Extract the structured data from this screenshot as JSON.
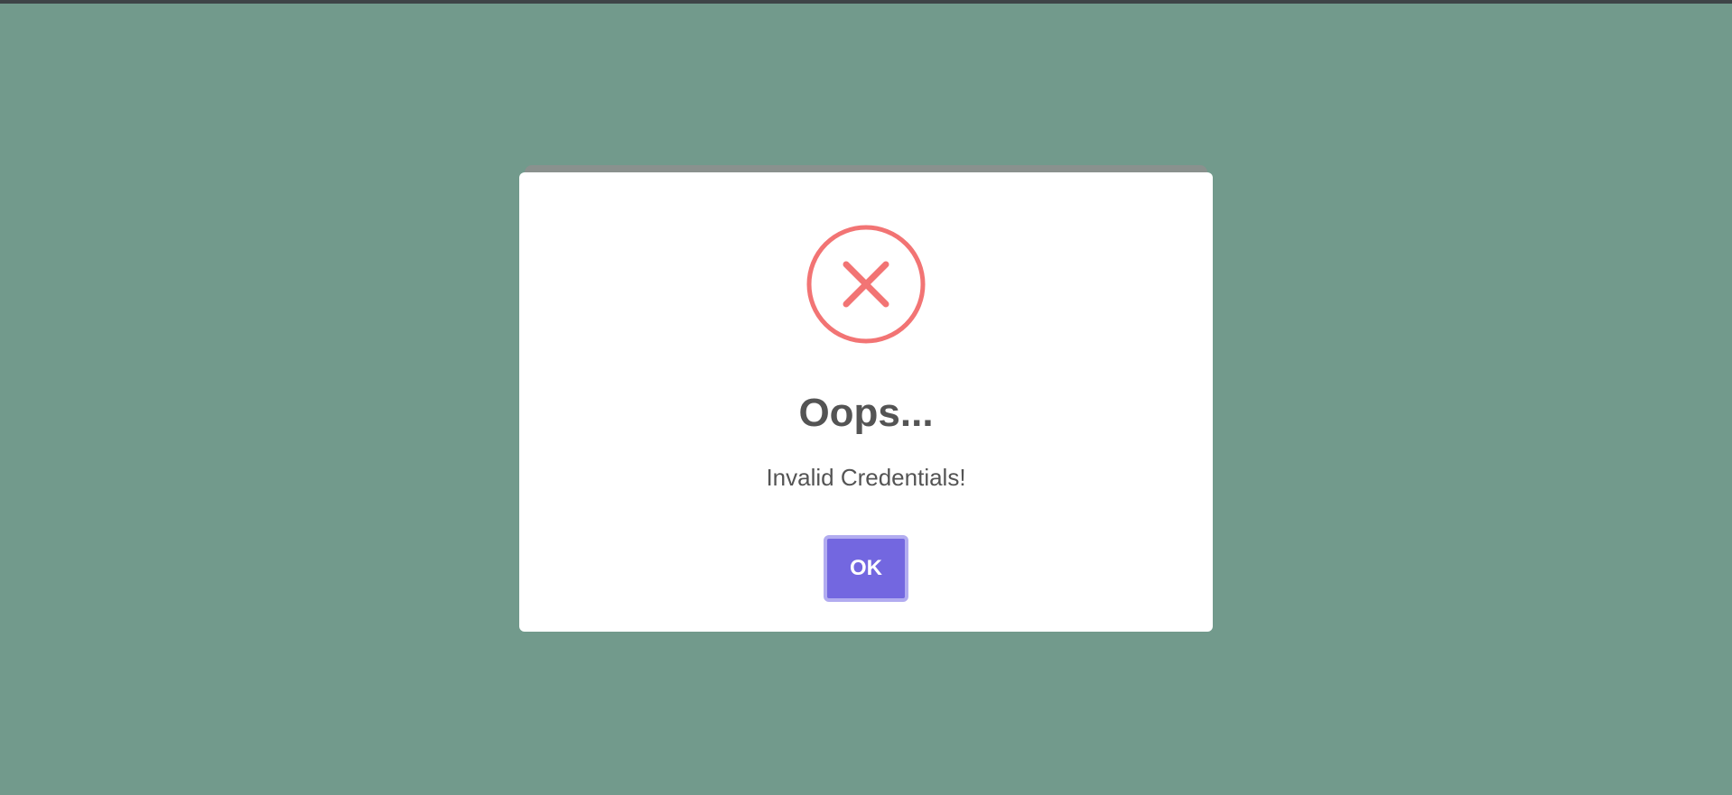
{
  "dialog": {
    "icon": "error-x-circle-icon",
    "title": "Oops...",
    "message": "Invalid Credentials!",
    "confirm_label": "OK"
  },
  "colors": {
    "background": "#729a8c",
    "dialog": "#ffffff",
    "error_accent": "#f27474",
    "button": "#7367e0",
    "button_focus_ring": "#b2acf0",
    "text": "#545454"
  }
}
